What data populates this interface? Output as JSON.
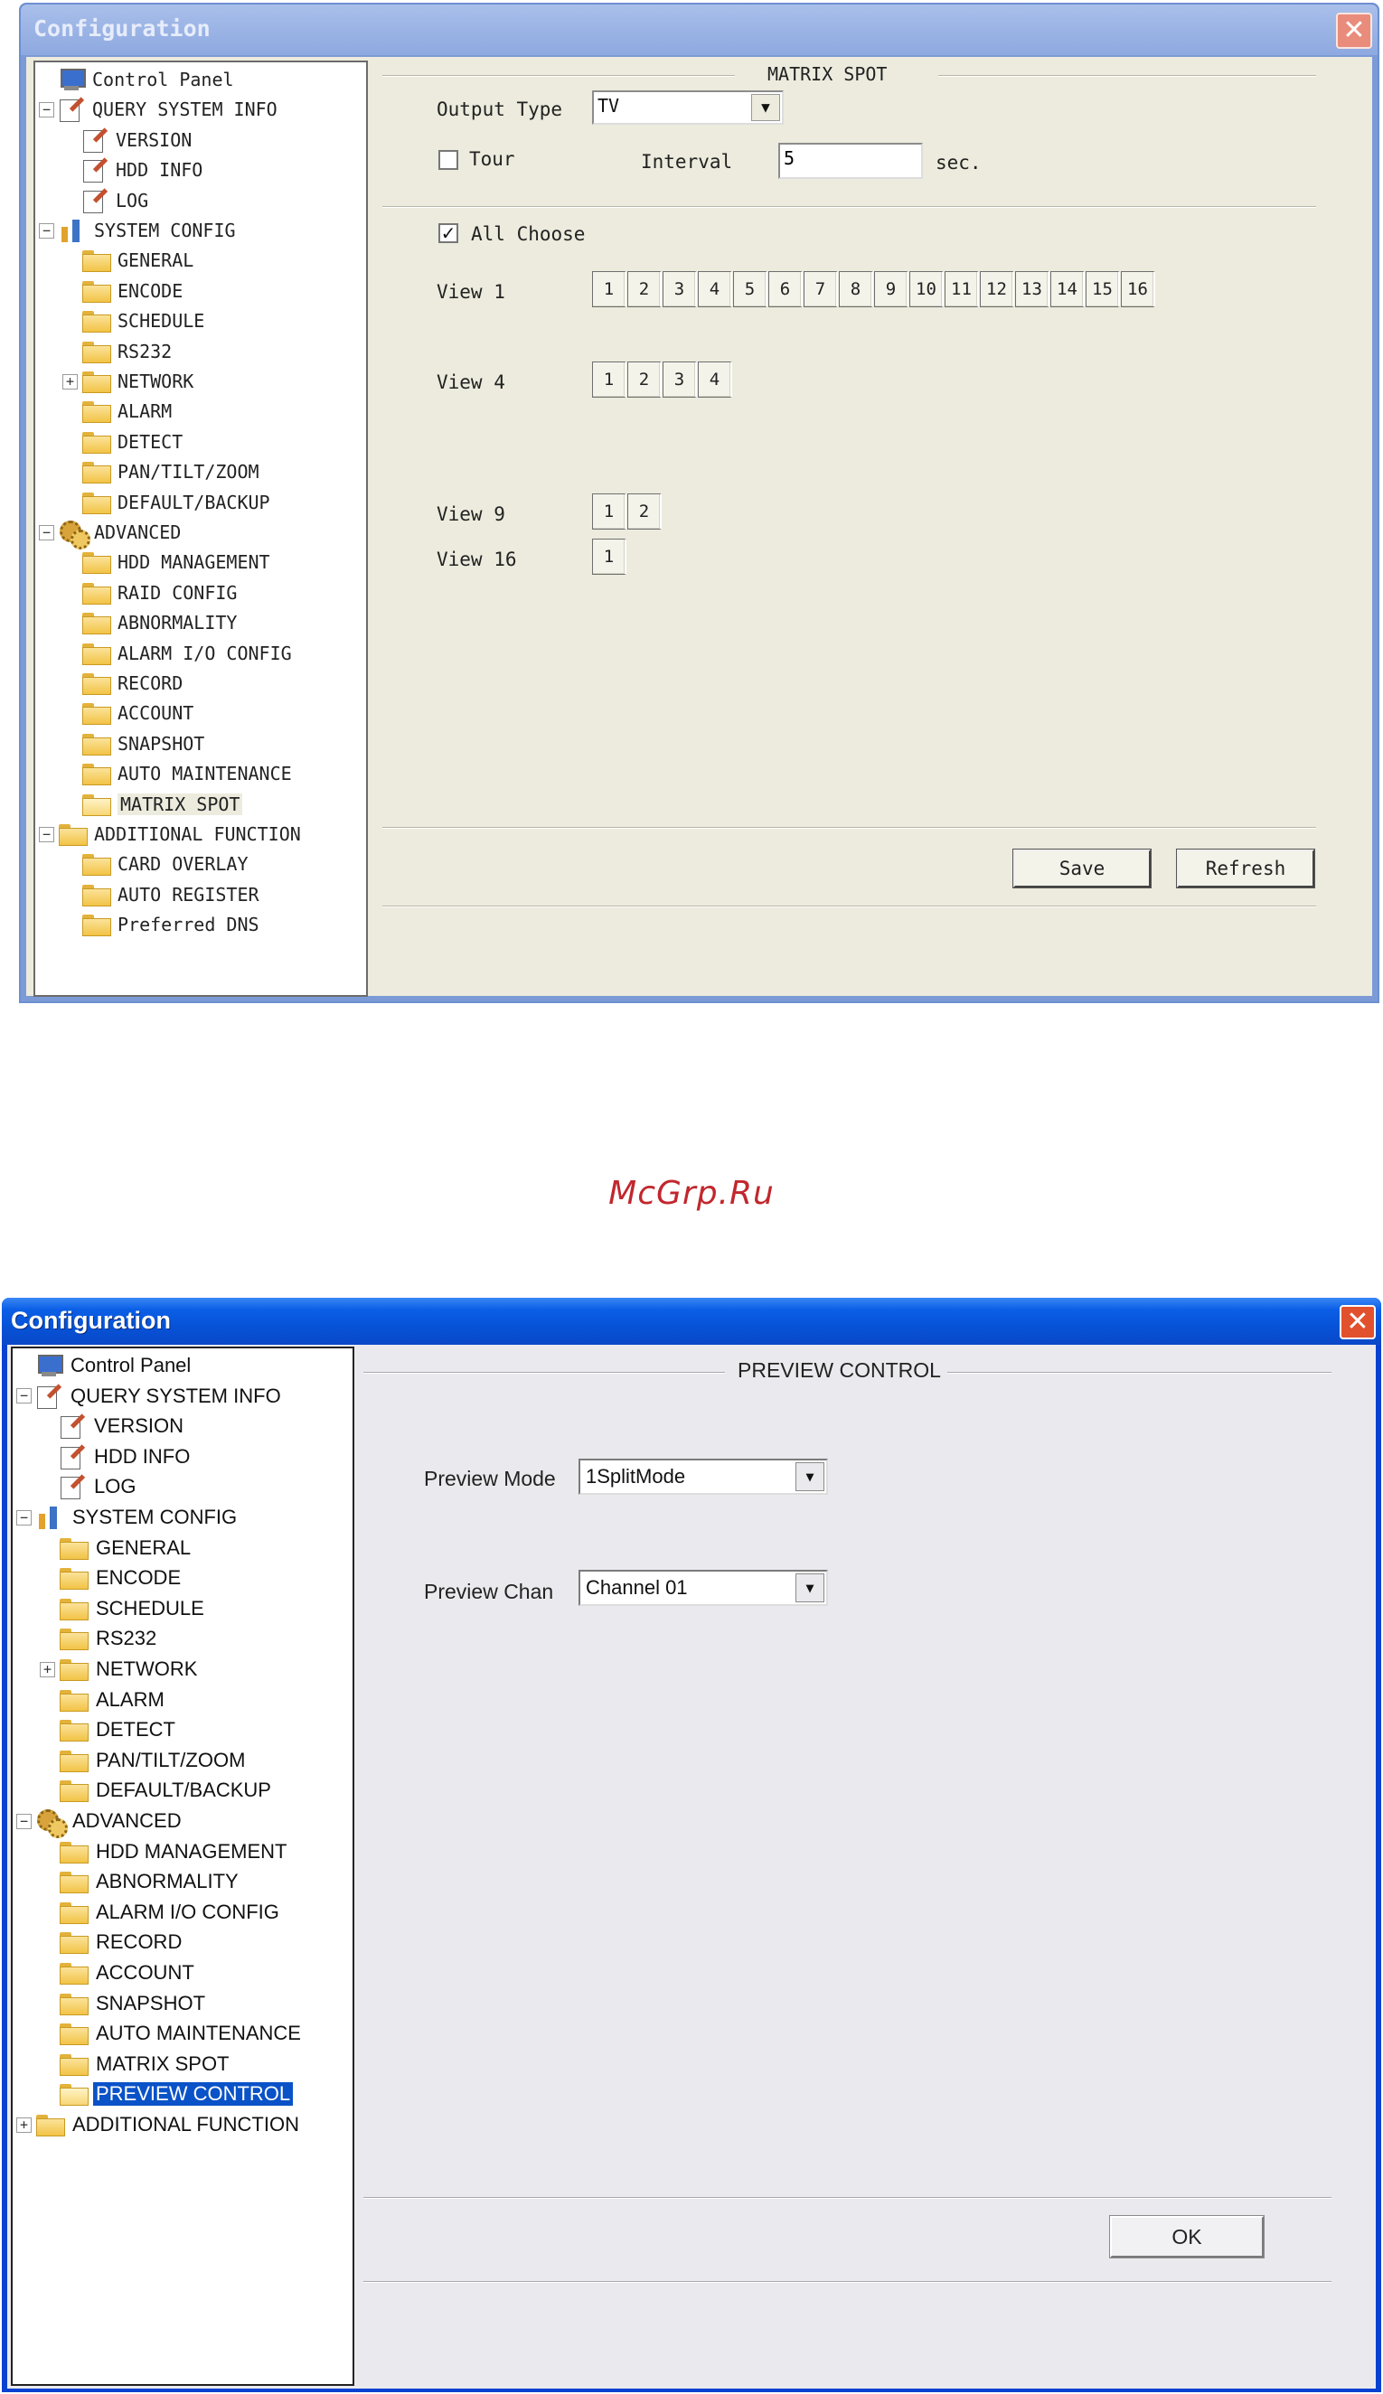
{
  "window1": {
    "title": "Configuration",
    "tree": [
      {
        "label": "Control Panel",
        "icon": "monitor-icon",
        "level": 0,
        "toggle": ""
      },
      {
        "label": "QUERY SYSTEM INFO",
        "icon": "note-icon",
        "level": 0,
        "toggle": "−"
      },
      {
        "label": "VERSION",
        "icon": "note-icon",
        "level": 1,
        "toggle": ""
      },
      {
        "label": "HDD INFO",
        "icon": "note-icon",
        "level": 1,
        "toggle": ""
      },
      {
        "label": "LOG",
        "icon": "note-icon",
        "level": 1,
        "toggle": ""
      },
      {
        "label": "SYSTEM CONFIG",
        "icon": "tools-icon",
        "level": 0,
        "toggle": "−"
      },
      {
        "label": "GENERAL",
        "icon": "folder-icon",
        "level": 1,
        "toggle": ""
      },
      {
        "label": "ENCODE",
        "icon": "folder-icon",
        "level": 1,
        "toggle": ""
      },
      {
        "label": "SCHEDULE",
        "icon": "folder-icon",
        "level": 1,
        "toggle": ""
      },
      {
        "label": "RS232",
        "icon": "folder-icon",
        "level": 1,
        "toggle": ""
      },
      {
        "label": "NETWORK",
        "icon": "folder-icon",
        "level": 1,
        "toggle": "+"
      },
      {
        "label": "ALARM",
        "icon": "folder-icon",
        "level": 1,
        "toggle": ""
      },
      {
        "label": "DETECT",
        "icon": "folder-icon",
        "level": 1,
        "toggle": ""
      },
      {
        "label": "PAN/TILT/ZOOM",
        "icon": "folder-icon",
        "level": 1,
        "toggle": ""
      },
      {
        "label": "DEFAULT/BACKUP",
        "icon": "folder-icon",
        "level": 1,
        "toggle": ""
      },
      {
        "label": "ADVANCED",
        "icon": "gears-icon",
        "level": 0,
        "toggle": "−"
      },
      {
        "label": "HDD MANAGEMENT",
        "icon": "folder-icon",
        "level": 1,
        "toggle": ""
      },
      {
        "label": "RAID CONFIG",
        "icon": "folder-icon",
        "level": 1,
        "toggle": ""
      },
      {
        "label": "ABNORMALITY",
        "icon": "folder-icon",
        "level": 1,
        "toggle": ""
      },
      {
        "label": "ALARM I/O CONFIG",
        "icon": "folder-icon",
        "level": 1,
        "toggle": ""
      },
      {
        "label": "RECORD",
        "icon": "folder-icon",
        "level": 1,
        "toggle": ""
      },
      {
        "label": "ACCOUNT",
        "icon": "folder-icon",
        "level": 1,
        "toggle": ""
      },
      {
        "label": "SNAPSHOT",
        "icon": "folder-icon",
        "level": 1,
        "toggle": ""
      },
      {
        "label": "AUTO MAINTENANCE",
        "icon": "folder-icon",
        "level": 1,
        "toggle": ""
      },
      {
        "label": "MATRIX SPOT",
        "icon": "folder-open-icon",
        "level": 1,
        "toggle": "",
        "selected": true
      },
      {
        "label": "ADDITIONAL FUNCTION",
        "icon": "folder-icon",
        "level": 0,
        "toggle": "−"
      },
      {
        "label": "CARD OVERLAY",
        "icon": "folder-icon",
        "level": 1,
        "toggle": ""
      },
      {
        "label": "AUTO REGISTER",
        "icon": "folder-icon",
        "level": 1,
        "toggle": ""
      },
      {
        "label": "Preferred DNS",
        "icon": "folder-icon",
        "level": 1,
        "toggle": ""
      }
    ],
    "section_title": "MATRIX SPOT",
    "output_type_label": "Output Type",
    "output_type_value": "TV",
    "tour_label": "Tour",
    "tour_checked": false,
    "interval_label": "Interval",
    "interval_value": "5",
    "interval_unit": "sec.",
    "all_choose_label": "All Choose",
    "all_choose_checked": true,
    "views": [
      {
        "label": "View 1",
        "cells": [
          "1",
          "2",
          "3",
          "4",
          "5",
          "6",
          "7",
          "8",
          "9",
          "10",
          "11",
          "12",
          "13",
          "14",
          "15",
          "16"
        ]
      },
      {
        "label": "View 4",
        "cells": [
          "1",
          "2",
          "3",
          "4"
        ]
      },
      {
        "label": "View 9",
        "cells": [
          "1",
          "2"
        ]
      },
      {
        "label": "View 16",
        "cells": [
          "1"
        ]
      }
    ],
    "save_label": "Save",
    "refresh_label": "Refresh"
  },
  "watermark": "McGrp.Ru",
  "window2": {
    "title": "Configuration",
    "tree": [
      {
        "label": "Control Panel",
        "icon": "monitor-icon",
        "level": 0,
        "toggle": ""
      },
      {
        "label": "QUERY SYSTEM INFO",
        "icon": "note-icon",
        "level": 0,
        "toggle": "−"
      },
      {
        "label": "VERSION",
        "icon": "note-icon",
        "level": 1,
        "toggle": ""
      },
      {
        "label": "HDD INFO",
        "icon": "note-icon",
        "level": 1,
        "toggle": ""
      },
      {
        "label": "LOG",
        "icon": "note-icon",
        "level": 1,
        "toggle": ""
      },
      {
        "label": "SYSTEM CONFIG",
        "icon": "tools-icon",
        "level": 0,
        "toggle": "−"
      },
      {
        "label": "GENERAL",
        "icon": "folder-icon",
        "level": 1,
        "toggle": ""
      },
      {
        "label": "ENCODE",
        "icon": "folder-icon",
        "level": 1,
        "toggle": ""
      },
      {
        "label": "SCHEDULE",
        "icon": "folder-icon",
        "level": 1,
        "toggle": ""
      },
      {
        "label": "RS232",
        "icon": "folder-icon",
        "level": 1,
        "toggle": ""
      },
      {
        "label": "NETWORK",
        "icon": "folder-icon",
        "level": 1,
        "toggle": "+"
      },
      {
        "label": "ALARM",
        "icon": "folder-icon",
        "level": 1,
        "toggle": ""
      },
      {
        "label": "DETECT",
        "icon": "folder-icon",
        "level": 1,
        "toggle": ""
      },
      {
        "label": "PAN/TILT/ZOOM",
        "icon": "folder-icon",
        "level": 1,
        "toggle": ""
      },
      {
        "label": "DEFAULT/BACKUP",
        "icon": "folder-icon",
        "level": 1,
        "toggle": ""
      },
      {
        "label": "ADVANCED",
        "icon": "gears-icon",
        "level": 0,
        "toggle": "−"
      },
      {
        "label": "HDD MANAGEMENT",
        "icon": "folder-icon",
        "level": 1,
        "toggle": ""
      },
      {
        "label": "ABNORMALITY",
        "icon": "folder-icon",
        "level": 1,
        "toggle": ""
      },
      {
        "label": "ALARM I/O CONFIG",
        "icon": "folder-icon",
        "level": 1,
        "toggle": ""
      },
      {
        "label": "RECORD",
        "icon": "folder-icon",
        "level": 1,
        "toggle": ""
      },
      {
        "label": "ACCOUNT",
        "icon": "folder-icon",
        "level": 1,
        "toggle": ""
      },
      {
        "label": "SNAPSHOT",
        "icon": "folder-icon",
        "level": 1,
        "toggle": ""
      },
      {
        "label": "AUTO MAINTENANCE",
        "icon": "folder-icon",
        "level": 1,
        "toggle": ""
      },
      {
        "label": "MATRIX SPOT",
        "icon": "folder-icon",
        "level": 1,
        "toggle": ""
      },
      {
        "label": "PREVIEW CONTROL",
        "icon": "folder-open-icon",
        "level": 1,
        "toggle": "",
        "selected": true
      },
      {
        "label": "ADDITIONAL FUNCTION",
        "icon": "folder-icon",
        "level": 0,
        "toggle": "+"
      }
    ],
    "section_title": "PREVIEW CONTROL",
    "preview_mode_label": "Preview Mode",
    "preview_mode_value": "1SplitMode",
    "preview_chan_label": "Preview Chan",
    "preview_chan_value": "Channel 01",
    "ok_label": "OK"
  },
  "colors": {
    "win1_title_bg": "#8ea9e0",
    "win2_title_bg": "#0653d8",
    "selection": "#0a52c8",
    "watermark": "#c1272d"
  }
}
